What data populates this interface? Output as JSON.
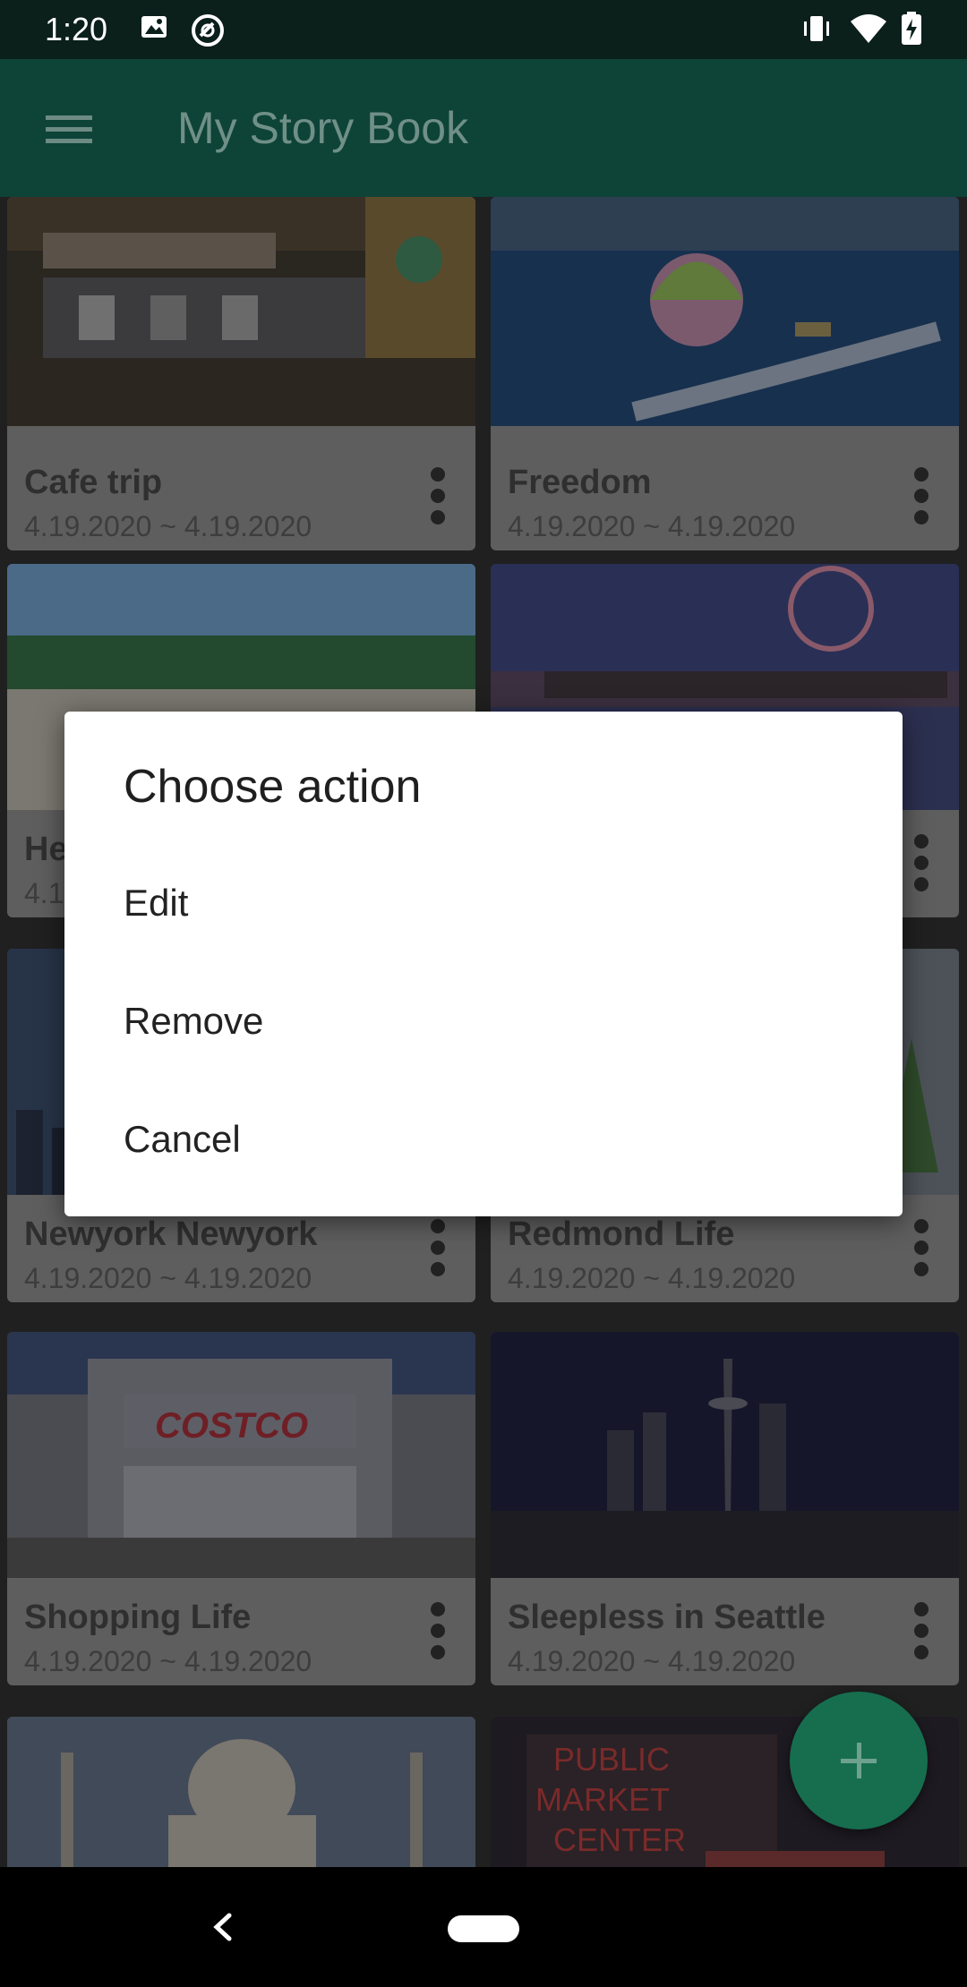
{
  "status_bar": {
    "time": "1:20",
    "left_icons": [
      "image-icon",
      "sync-icon"
    ],
    "right_icons": [
      "vibrate-icon",
      "wifi-icon",
      "battery-charging-icon"
    ]
  },
  "app_bar": {
    "title": "My Story Book",
    "menu_icon": "hamburger-menu-icon"
  },
  "stories": [
    {
      "title": "Cafe trip",
      "dates": "4.19.2020 ~ 4.19.2020"
    },
    {
      "title": "Freedom",
      "dates": "4.19.2020 ~ 4.19.2020"
    },
    {
      "title": "He",
      "dates": "4.1"
    },
    {
      "title": "",
      "dates": ""
    },
    {
      "title": "Newyork Newyork",
      "dates": "4.19.2020 ~ 4.19.2020"
    },
    {
      "title": "Redmond Life",
      "dates": "4.19.2020 ~ 4.19.2020"
    },
    {
      "title": "Shopping Life",
      "dates": "4.19.2020 ~ 4.19.2020"
    },
    {
      "title": "Sleepless in Seattle",
      "dates": "4.19.2020 ~ 4.19.2020"
    }
  ],
  "dialog": {
    "title": "Choose action",
    "items": [
      "Edit",
      "Remove",
      "Cancel"
    ]
  },
  "fab": {
    "icon": "plus-icon"
  },
  "nav_bar": {
    "back_icon": "back-chevron-icon",
    "home_icon": "home-pill-icon"
  },
  "colors": {
    "app_bar": "#0e4338",
    "status_bar": "#0b1f1b",
    "fab": "#166e4f",
    "dialog": "#ffffff"
  }
}
